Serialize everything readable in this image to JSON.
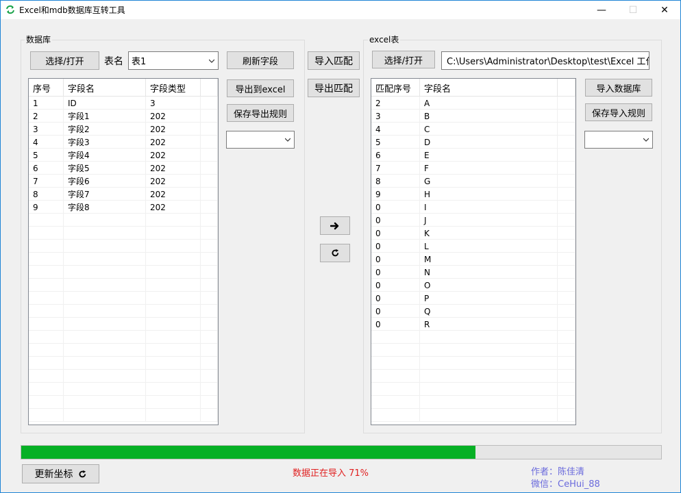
{
  "window": {
    "title": "Excel和mdb数据库互转工具",
    "min_glyph": "—",
    "max_glyph": "☐",
    "close_glyph": "✕"
  },
  "db_group": {
    "title": "数据库",
    "open_button": "选择/打开",
    "table_label": "表名",
    "table_value": "表1",
    "refresh_button": "刷新字段",
    "export_button": "导出到excel",
    "save_export_rule_button": "保存导出规则",
    "rule_select_value": "",
    "grid": {
      "columns": [
        "序号",
        "字段名",
        "字段类型",
        ""
      ],
      "rows": [
        [
          "1",
          "ID",
          "3"
        ],
        [
          "2",
          "字段1",
          "202"
        ],
        [
          "3",
          "字段2",
          "202"
        ],
        [
          "4",
          "字段3",
          "202"
        ],
        [
          "5",
          "字段4",
          "202"
        ],
        [
          "6",
          "字段5",
          "202"
        ],
        [
          "7",
          "字段6",
          "202"
        ],
        [
          "8",
          "字段7",
          "202"
        ],
        [
          "9",
          "字段8",
          "202"
        ]
      ]
    }
  },
  "middle": {
    "import_match_button": "导入匹配",
    "export_match_button": "导出匹配",
    "arrow_icon": "arrow-right-icon",
    "refresh_icon": "refresh-icon"
  },
  "excel_group": {
    "title": "excel表",
    "open_button": "选择/打开",
    "path_value": "C:\\Users\\Administrator\\Desktop\\test\\Excel 工作",
    "import_db_button": "导入数据库",
    "save_import_rule_button": "保存导入规则",
    "rule_select_value": "",
    "grid": {
      "columns": [
        "匹配序号",
        "字段名",
        ""
      ],
      "rows": [
        [
          "2",
          "A"
        ],
        [
          "3",
          "B"
        ],
        [
          "4",
          "C"
        ],
        [
          "5",
          "D"
        ],
        [
          "6",
          "E"
        ],
        [
          "7",
          "F"
        ],
        [
          "8",
          "G"
        ],
        [
          "9",
          "H"
        ],
        [
          "0",
          "I"
        ],
        [
          "0",
          "J"
        ],
        [
          "0",
          "K"
        ],
        [
          "0",
          "L"
        ],
        [
          "0",
          "M"
        ],
        [
          "0",
          "N"
        ],
        [
          "0",
          "O"
        ],
        [
          "0",
          "P"
        ],
        [
          "0",
          "Q"
        ],
        [
          "0",
          "R"
        ]
      ]
    }
  },
  "footer": {
    "update_coords_button": "更新坐标",
    "progress_percent": 71,
    "status_text": "数据正在导入 71%",
    "author_line": "作者：陈佳清",
    "wechat_line": "微信：CeHui_88"
  },
  "colors": {
    "progress": "#06b025",
    "status": "#e02020",
    "author": "#6a6adc"
  }
}
